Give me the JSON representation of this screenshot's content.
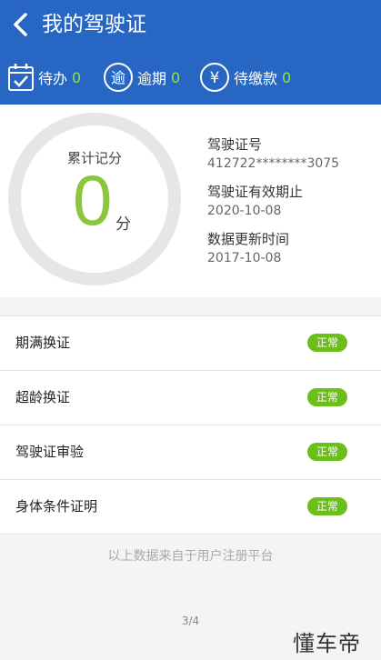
{
  "header": {
    "title": "我的驾驶证",
    "stats": [
      {
        "label": "待办",
        "count": "0",
        "icon": "calendar-icon"
      },
      {
        "label": "逾期",
        "count": "0",
        "icon": "overdue-icon"
      },
      {
        "label": "待缴款",
        "count": "0",
        "icon": "yuan-icon"
      }
    ],
    "icon_glyphs": {
      "overdue": "逾",
      "yuan": "¥"
    }
  },
  "summary": {
    "ring_label": "累计记分",
    "points": "0",
    "points_unit": "分",
    "license_no_label": "驾驶证号",
    "license_no": "412722********3075",
    "expiry_label": "驾驶证有效期止",
    "expiry": "2020-10-08",
    "updated_label": "数据更新时间",
    "updated": "2017-10-08"
  },
  "items": [
    {
      "label": "期满换证",
      "status": "正常"
    },
    {
      "label": "超龄换证",
      "status": "正常"
    },
    {
      "label": "驾驶证审验",
      "status": "正常"
    },
    {
      "label": "身体条件证明",
      "status": "正常"
    }
  ],
  "footnote": "以上数据来自于用户注册平台",
  "pager": "3/4",
  "watermark": "懂车帝",
  "colors": {
    "header": "#2767c3",
    "accent_green": "#8cc63f",
    "badge": "#6cbf1a",
    "ring": "#e6e6e6"
  }
}
